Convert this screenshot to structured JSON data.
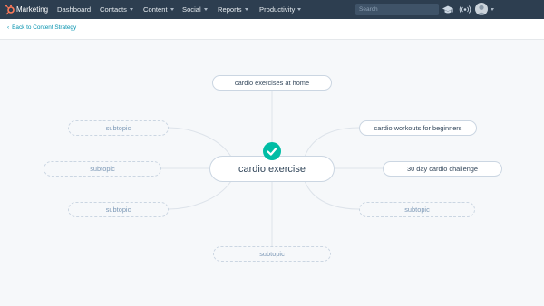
{
  "nav": {
    "brand": "Marketing",
    "items": [
      {
        "label": "Dashboard",
        "has_caret": false
      },
      {
        "label": "Contacts",
        "has_caret": true
      },
      {
        "label": "Content",
        "has_caret": true
      },
      {
        "label": "Social",
        "has_caret": true
      },
      {
        "label": "Reports",
        "has_caret": true
      },
      {
        "label": "Productivity",
        "has_caret": true
      }
    ],
    "search_placeholder": "Search",
    "icons": [
      "graduation-cap-icon",
      "broadcast-icon",
      "user-avatar-icon"
    ]
  },
  "subheader": {
    "back_label": "Back to Content Strategy"
  },
  "mindmap": {
    "center": "cardio exercise",
    "center_status": "check-icon",
    "topics": [
      {
        "label": "cardio exercises at home",
        "placeholder": false
      },
      {
        "label": "cardio workouts for beginners",
        "placeholder": false
      },
      {
        "label": "30 day cardio challenge",
        "placeholder": false
      },
      {
        "label": "subtopic",
        "placeholder": true
      },
      {
        "label": "subtopic",
        "placeholder": true
      },
      {
        "label": "subtopic",
        "placeholder": true
      },
      {
        "label": "subtopic",
        "placeholder": true
      },
      {
        "label": "subtopic",
        "placeholder": true
      }
    ]
  },
  "colors": {
    "nav_bg": "#2d3e50",
    "accent_teal": "#00bda5",
    "link": "#0091ae",
    "canvas_bg": "#f6f8fa",
    "node_border": "#cbd6e2",
    "text_dark": "#33475b",
    "text_muted": "#7c98b6",
    "logo_orange": "#ff7a59"
  }
}
